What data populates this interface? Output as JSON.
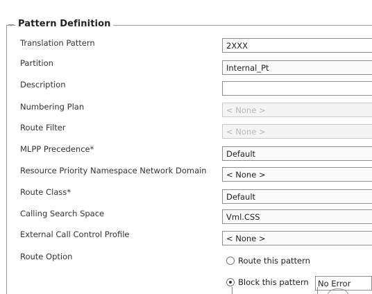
{
  "section": {
    "legend": "Pattern Definition"
  },
  "fields": [
    {
      "label": "Translation Pattern",
      "value": "2XXX",
      "state": "text"
    },
    {
      "label": "Partition",
      "value": "Internal_Pt",
      "state": "select"
    },
    {
      "label": "Description",
      "value": "",
      "state": "text"
    },
    {
      "label": "Numbering Plan",
      "value": "< None >",
      "state": "disabled"
    },
    {
      "label": "Route Filter",
      "value": "< None >",
      "state": "disabled"
    },
    {
      "label": "MLPP Precedence*",
      "value": "Default",
      "state": "select"
    },
    {
      "label": "Resource Priority Namespace Network Domain",
      "value": "< None >",
      "state": "select"
    },
    {
      "label": "Route Class*",
      "value": "Default",
      "state": "select"
    },
    {
      "label": "Calling Search Space",
      "value": "Vml.CSS",
      "state": "select"
    },
    {
      "label": "External Call Control Profile",
      "value": "< None >",
      "state": "select"
    }
  ],
  "route_option": {
    "label": "Route Option",
    "options": [
      {
        "label": "Route this pattern",
        "checked": false
      },
      {
        "label": "Block this pattern",
        "checked": true
      }
    ],
    "block_reason": "No Error"
  }
}
